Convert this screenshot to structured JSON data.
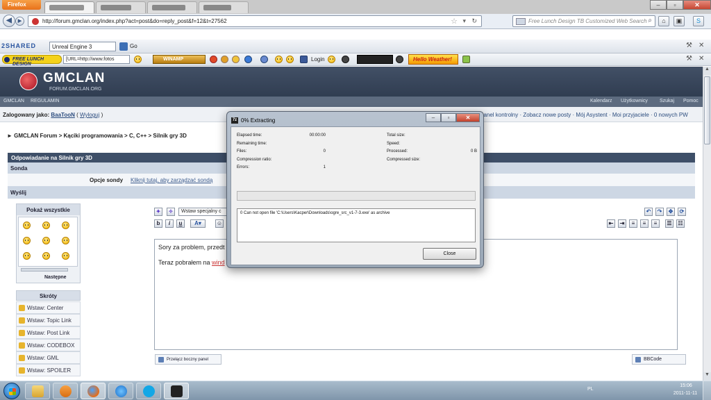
{
  "browser": {
    "app_menu": "Firefox",
    "url": "http://forum.gmclan.org/index.php?act=post&do=reply_post&f=12&t=27562",
    "search_placeholder": "Free Lunch Design TB Customized Web Search"
  },
  "toolbar1": {
    "brand": "2SHARED",
    "search_value": "Unreal Engine 3",
    "go_label": "Go"
  },
  "toolbar2": {
    "brand": "FREE LUNCH DESIGN",
    "url_value": "[URL=http://www.fotos",
    "winamp_label": "WINAMP",
    "login_label": "Login",
    "hello_label": "Hello Weather!"
  },
  "site": {
    "logo": "GMCLAN",
    "subtitle": "FORUM.GMCLAN.ORG",
    "nav_left": [
      "GMCLAN",
      "REGULAMIN"
    ],
    "nav_right": [
      "Kalendarz",
      "Użytkownicy",
      "Szukaj",
      "Pomoc"
    ],
    "logged_label": "Zalogowany jako:",
    "username": "BaaTooN",
    "logout": "Wyloguj",
    "right_links": "panel kontrolny · Zobacz nowe posty · Mój Asystent · Moi przyjaciele · 0 nowych PW"
  },
  "breadcrumb": "GMCLAN Forum > Kąciki programowania > C, C++ > Silnik gry 3D",
  "form": {
    "reply_title": "Odpowiadanie na Silnik gry 3D",
    "poll_section": "Sonda",
    "poll_label": "Opcje sondy",
    "poll_link": "Kliknij tutaj, aby zarządzać sondą",
    "send_section": "Wyślij",
    "smilies_title": "Pokaż wszystkie",
    "smilies_next": "Następne",
    "shortcuts_title": "Skróty",
    "shortcuts": [
      "Wstaw: Center",
      "Wstaw: Topic Link",
      "Wstaw: Post Link",
      "Wstaw: CODEBOX",
      "Wstaw: GML",
      "Wstaw: SPOILER"
    ],
    "special_select": "Wstaw specjalny c",
    "editor_line1": "Sory za problem, przedt",
    "editor_line2_prefix": "Teraz pobrałem na ",
    "editor_line2_link": "wind",
    "toggle_panel": "Przełącz boczny panel",
    "bbcode": "BBCode"
  },
  "dialog": {
    "title": "0% Extracting",
    "fields_left": [
      {
        "label": "Elapsed time:",
        "value": "00:00:00"
      },
      {
        "label": "Remaining time:",
        "value": ""
      },
      {
        "label": "Files:",
        "value": "0"
      },
      {
        "label": "Compression ratio:",
        "value": ""
      },
      {
        "label": "Errors:",
        "value": "1"
      }
    ],
    "fields_right": [
      {
        "label": "Total size:",
        "value": ""
      },
      {
        "label": "Speed:",
        "value": ""
      },
      {
        "label": "Processed:",
        "value": "0 B"
      },
      {
        "label": "Compressed size:",
        "value": ""
      }
    ],
    "progress": 0,
    "message": "0   Can not open file 'C:\\Users\\Kacper\\Downloads\\ogre_src_v1-7-3.exe' as archive",
    "close_label": "Close"
  },
  "taskbar": {
    "language": "PL",
    "time": "15:06",
    "date": "2011-11-11",
    "apps": [
      "explorer",
      "media-player",
      "firefox",
      "internet-explorer",
      "skype",
      "7zip"
    ]
  },
  "colors": {
    "header_dark": "#303d51",
    "section_blue": "#cdd7e4",
    "reply_header": "#3e4f68"
  }
}
